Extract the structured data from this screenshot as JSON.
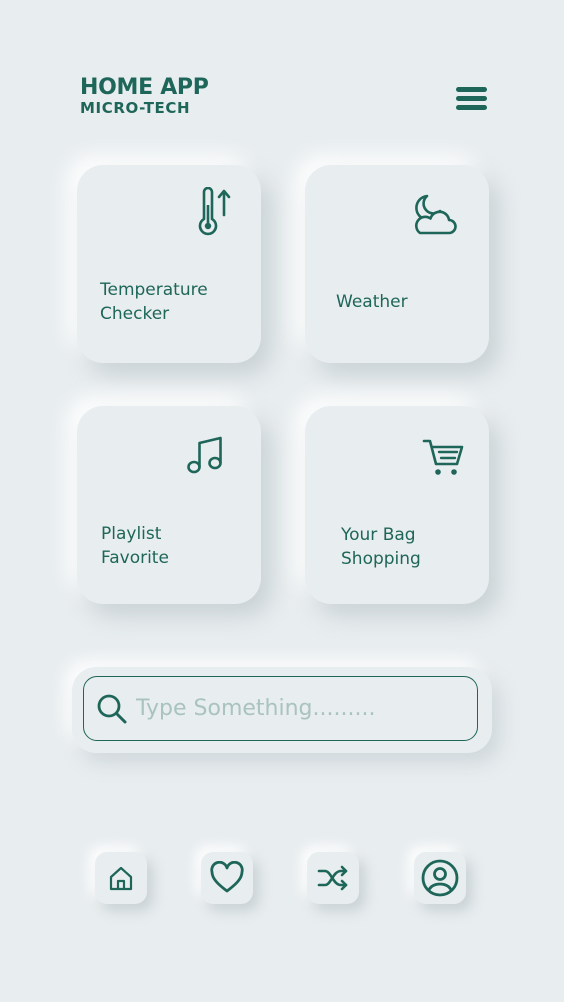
{
  "header": {
    "title": "HOME APP",
    "subtitle": "MICRO-TECH",
    "menu_icon": "hamburger-menu-icon"
  },
  "cards": [
    {
      "id": "temperature",
      "icon": "thermometer-icon",
      "lines": [
        "Temperature",
        "Checker"
      ]
    },
    {
      "id": "weather",
      "icon": "moon-cloud-icon",
      "lines": [
        "Weather"
      ]
    },
    {
      "id": "playlist",
      "icon": "music-note-icon",
      "lines": [
        "Playlist",
        "Favorite"
      ]
    },
    {
      "id": "bag",
      "icon": "shopping-cart-icon",
      "lines": [
        "Your Bag",
        "Shopping"
      ]
    }
  ],
  "search": {
    "placeholder": "Type Something.........",
    "value": "",
    "icon": "search-icon"
  },
  "bottom_nav": [
    {
      "id": "home",
      "icon": "home-icon"
    },
    {
      "id": "favorites",
      "icon": "heart-icon"
    },
    {
      "id": "shuffle",
      "icon": "shuffle-icon"
    },
    {
      "id": "profile",
      "icon": "user-circle-icon"
    }
  ],
  "colors": {
    "accent": "#1e6659",
    "background": "#e8edef",
    "placeholder": "#a9c3bf"
  }
}
